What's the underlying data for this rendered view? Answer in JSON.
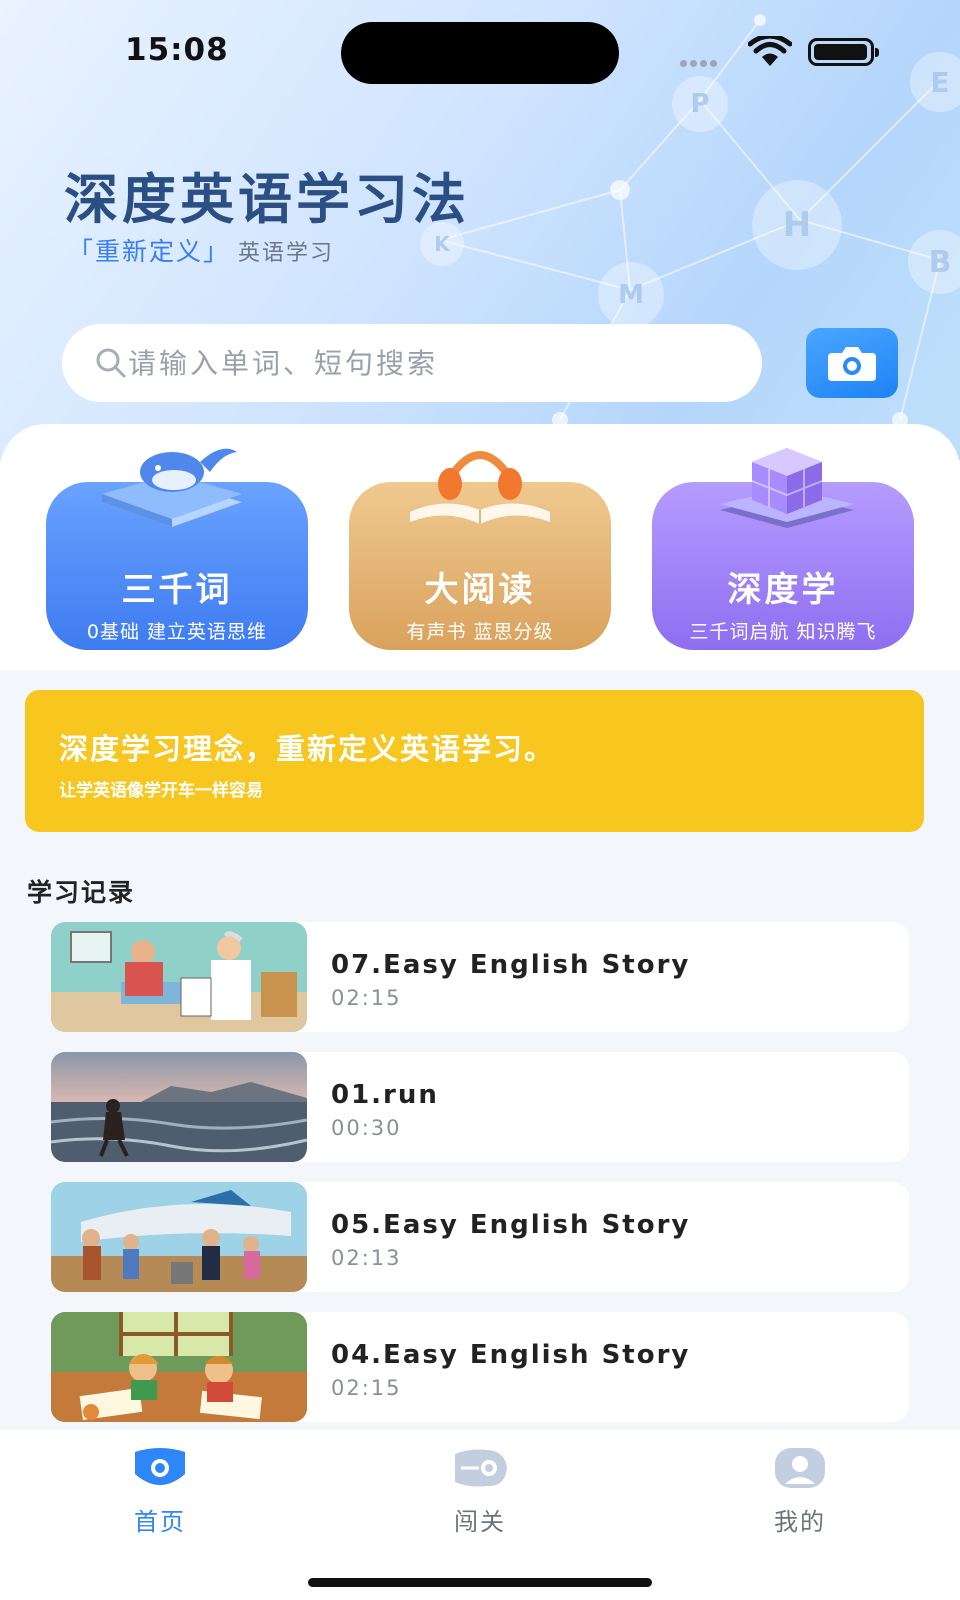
{
  "status_bar": {
    "time": "15:08"
  },
  "header": {
    "title": "深度英语学习法",
    "subtitle_highlight": "「重新定义」",
    "subtitle_rest": "英语学习",
    "bubbles": [
      "P",
      "H",
      "B",
      "E",
      "K",
      "M"
    ]
  },
  "search": {
    "placeholder": "请输入单词、短句搜索",
    "value": ""
  },
  "camera": {
    "icon": "camera-icon"
  },
  "feature_cards": [
    {
      "title": "三千词",
      "subtitle": "0基础 建立英语思维",
      "icon": "whale-book-icon"
    },
    {
      "title": "大阅读",
      "subtitle": "有声书 蓝思分级",
      "icon": "headphones-book-icon"
    },
    {
      "title": "深度学",
      "subtitle": "三千词启航 知识腾飞",
      "icon": "cube-book-icon"
    }
  ],
  "banner": {
    "headline": "深度学习理念，重新定义英语学习。",
    "tagline": "让学英语像学开车一样容易"
  },
  "records_section": {
    "title": "学习记录",
    "items": [
      {
        "name": "07.Easy English Story",
        "duration": "02:15",
        "thumb": "doctor-scene"
      },
      {
        "name": "01.run",
        "duration": "00:30",
        "thumb": "beach-scene"
      },
      {
        "name": "05.Easy English Story",
        "duration": "02:13",
        "thumb": "airport-scene"
      },
      {
        "name": "04.Easy English Story",
        "duration": "02:15",
        "thumb": "kids-room-scene"
      }
    ]
  },
  "tabbar": {
    "items": [
      {
        "label": "首页",
        "icon": "home-eye-icon",
        "active": true
      },
      {
        "label": "闯关",
        "icon": "challenge-icon",
        "active": false
      },
      {
        "label": "我的",
        "icon": "profile-icon",
        "active": false
      }
    ]
  },
  "colors": {
    "accent": "#2f86f6",
    "banner": "#f7c61f",
    "title": "#2b4f83"
  }
}
